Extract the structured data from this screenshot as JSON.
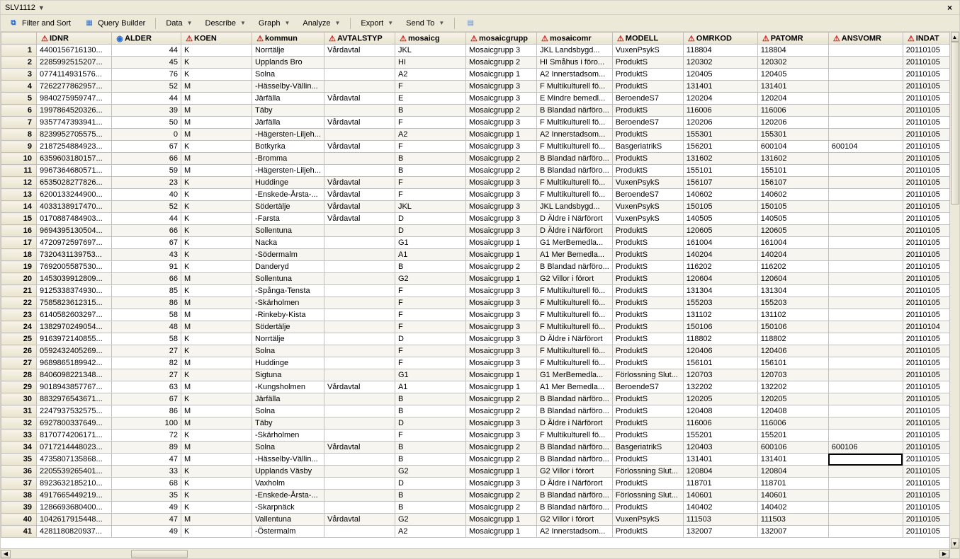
{
  "title": "SLV1112",
  "toolbar": {
    "filterSort": "Filter and Sort",
    "queryBuilder": "Query Builder",
    "data": "Data",
    "describe": "Describe",
    "graph": "Graph",
    "analyze": "Analyze",
    "export": "Export",
    "sendTo": "Send To"
  },
  "columns": [
    {
      "key": "IDNR",
      "label": "IDNR",
      "icon": "warn",
      "w": "col-idnr"
    },
    {
      "key": "ALDER",
      "label": "ALDER",
      "icon": "globe",
      "w": "col-alder"
    },
    {
      "key": "KOEN",
      "label": "KOEN",
      "icon": "warn",
      "w": "col-koen"
    },
    {
      "key": "kommun",
      "label": "kommun",
      "icon": "warn",
      "w": "col-kommun"
    },
    {
      "key": "AVTALSTYP",
      "label": "AVTALSTYP",
      "icon": "warn",
      "w": "col-avtal"
    },
    {
      "key": "mosaicg",
      "label": "mosaicg",
      "icon": "warn",
      "w": "col-mosaicg"
    },
    {
      "key": "mosaicgrupp",
      "label": "mosaicgrupp",
      "icon": "warn",
      "w": "col-mgrp"
    },
    {
      "key": "mosaicomr",
      "label": "mosaicomr",
      "icon": "warn",
      "w": "col-momr"
    },
    {
      "key": "MODELL",
      "label": "MODELL",
      "icon": "warn",
      "w": "col-modell"
    },
    {
      "key": "OMRKOD",
      "label": "OMRKOD",
      "icon": "warn",
      "w": "col-omrkod"
    },
    {
      "key": "PATOMR",
      "label": "PATOMR",
      "icon": "warn",
      "w": "col-patomr"
    },
    {
      "key": "ANSVOMR",
      "label": "ANSVOMR",
      "icon": "warn",
      "w": "col-ansvomr"
    },
    {
      "key": "INDAT",
      "label": "INDAT",
      "icon": "warn",
      "w": "col-indat"
    }
  ],
  "rows": [
    {
      "n": 1,
      "IDNR": "4400156716130...",
      "ALDER": 44,
      "KOEN": "K",
      "kommun": "Norrtälje",
      "AVTALSTYP": "Vårdavtal",
      "mosaicg": "JKL",
      "mosaicgrupp": "Mosaicgrupp 3",
      "mosaicomr": "JKL Landsbygd...",
      "MODELL": "VuxenPsykS",
      "OMRKOD": "118804",
      "PATOMR": "118804",
      "ANSVOMR": "",
      "INDAT": "20110105"
    },
    {
      "n": 2,
      "IDNR": "2285992515207...",
      "ALDER": 45,
      "KOEN": "K",
      "kommun": "Upplands Bro",
      "AVTALSTYP": "",
      "mosaicg": "HI",
      "mosaicgrupp": "Mosaicgrupp 2",
      "mosaicomr": "HI Småhus i föro...",
      "MODELL": "ProduktS",
      "OMRKOD": "120302",
      "PATOMR": "120302",
      "ANSVOMR": "",
      "INDAT": "20110105"
    },
    {
      "n": 3,
      "IDNR": "0774114931576...",
      "ALDER": 76,
      "KOEN": "K",
      "kommun": "Solna",
      "AVTALSTYP": "",
      "mosaicg": "A2",
      "mosaicgrupp": "Mosaicgrupp 1",
      "mosaicomr": "A2 Innerstadsom...",
      "MODELL": "ProduktS",
      "OMRKOD": "120405",
      "PATOMR": "120405",
      "ANSVOMR": "",
      "INDAT": "20110105"
    },
    {
      "n": 4,
      "IDNR": "7262277862957...",
      "ALDER": 52,
      "KOEN": "M",
      "kommun": "-Hässelby-Vällin...",
      "AVTALSTYP": "",
      "mosaicg": "F",
      "mosaicgrupp": "Mosaicgrupp 3",
      "mosaicomr": "F Multikulturell fö...",
      "MODELL": "ProduktS",
      "OMRKOD": "131401",
      "PATOMR": "131401",
      "ANSVOMR": "",
      "INDAT": "20110105"
    },
    {
      "n": 5,
      "IDNR": "9840275959747...",
      "ALDER": 44,
      "KOEN": "M",
      "kommun": "Järfälla",
      "AVTALSTYP": "Vårdavtal",
      "mosaicg": "E",
      "mosaicgrupp": "Mosaicgrupp 3",
      "mosaicomr": "E Mindre bemedl...",
      "MODELL": "BeroendeS7",
      "OMRKOD": "120204",
      "PATOMR": "120204",
      "ANSVOMR": "",
      "INDAT": "20110105"
    },
    {
      "n": 6,
      "IDNR": "1997864520326...",
      "ALDER": 39,
      "KOEN": "M",
      "kommun": "Täby",
      "AVTALSTYP": "",
      "mosaicg": "B",
      "mosaicgrupp": "Mosaicgrupp 2",
      "mosaicomr": "B Blandad närföro...",
      "MODELL": "ProduktS",
      "OMRKOD": "116006",
      "PATOMR": "116006",
      "ANSVOMR": "",
      "INDAT": "20110105"
    },
    {
      "n": 7,
      "IDNR": "9357747393941...",
      "ALDER": 50,
      "KOEN": "M",
      "kommun": "Järfälla",
      "AVTALSTYP": "Vårdavtal",
      "mosaicg": "F",
      "mosaicgrupp": "Mosaicgrupp 3",
      "mosaicomr": "F Multikulturell fö...",
      "MODELL": "BeroendeS7",
      "OMRKOD": "120206",
      "PATOMR": "120206",
      "ANSVOMR": "",
      "INDAT": "20110105"
    },
    {
      "n": 8,
      "IDNR": "8239952705575...",
      "ALDER": 0,
      "KOEN": "M",
      "kommun": "-Hägersten-Liljeh...",
      "AVTALSTYP": "",
      "mosaicg": "A2",
      "mosaicgrupp": "Mosaicgrupp 1",
      "mosaicomr": "A2 Innerstadsom...",
      "MODELL": "ProduktS",
      "OMRKOD": "155301",
      "PATOMR": "155301",
      "ANSVOMR": "",
      "INDAT": "20110105"
    },
    {
      "n": 9,
      "IDNR": "2187254884923...",
      "ALDER": 67,
      "KOEN": "K",
      "kommun": "Botkyrka",
      "AVTALSTYP": "Vårdavtal",
      "mosaicg": "F",
      "mosaicgrupp": "Mosaicgrupp 3",
      "mosaicomr": "F Multikulturell fö...",
      "MODELL": "BasgeriatrikS",
      "OMRKOD": "156201",
      "PATOMR": "600104",
      "ANSVOMR": "600104",
      "INDAT": "20110105"
    },
    {
      "n": 10,
      "IDNR": "6359603180157...",
      "ALDER": 66,
      "KOEN": "M",
      "kommun": "-Bromma",
      "AVTALSTYP": "",
      "mosaicg": "B",
      "mosaicgrupp": "Mosaicgrupp 2",
      "mosaicomr": "B Blandad närföro...",
      "MODELL": "ProduktS",
      "OMRKOD": "131602",
      "PATOMR": "131602",
      "ANSVOMR": "",
      "INDAT": "20110105"
    },
    {
      "n": 11,
      "IDNR": "9967364680571...",
      "ALDER": 59,
      "KOEN": "M",
      "kommun": "-Hägersten-Liljeh...",
      "AVTALSTYP": "",
      "mosaicg": "B",
      "mosaicgrupp": "Mosaicgrupp 2",
      "mosaicomr": "B Blandad närföro...",
      "MODELL": "ProduktS",
      "OMRKOD": "155101",
      "PATOMR": "155101",
      "ANSVOMR": "",
      "INDAT": "20110105"
    },
    {
      "n": 12,
      "IDNR": "6535028277826...",
      "ALDER": 23,
      "KOEN": "K",
      "kommun": "Huddinge",
      "AVTALSTYP": "Vårdavtal",
      "mosaicg": "F",
      "mosaicgrupp": "Mosaicgrupp 3",
      "mosaicomr": "F Multikulturell fö...",
      "MODELL": "VuxenPsykS",
      "OMRKOD": "156107",
      "PATOMR": "156107",
      "ANSVOMR": "",
      "INDAT": "20110105"
    },
    {
      "n": 13,
      "IDNR": "6200133244900...",
      "ALDER": 40,
      "KOEN": "K",
      "kommun": "-Enskede-Årsta-...",
      "AVTALSTYP": "Vårdavtal",
      "mosaicg": "F",
      "mosaicgrupp": "Mosaicgrupp 3",
      "mosaicomr": "F Multikulturell fö...",
      "MODELL": "BeroendeS7",
      "OMRKOD": "140602",
      "PATOMR": "140602",
      "ANSVOMR": "",
      "INDAT": "20110105"
    },
    {
      "n": 14,
      "IDNR": "4033138917470...",
      "ALDER": 52,
      "KOEN": "K",
      "kommun": "Södertälje",
      "AVTALSTYP": "Vårdavtal",
      "mosaicg": "JKL",
      "mosaicgrupp": "Mosaicgrupp 3",
      "mosaicomr": "JKL Landsbygd...",
      "MODELL": "VuxenPsykS",
      "OMRKOD": "150105",
      "PATOMR": "150105",
      "ANSVOMR": "",
      "INDAT": "20110105"
    },
    {
      "n": 15,
      "IDNR": "0170887484903...",
      "ALDER": 44,
      "KOEN": "K",
      "kommun": "-Farsta",
      "AVTALSTYP": "Vårdavtal",
      "mosaicg": "D",
      "mosaicgrupp": "Mosaicgrupp 3",
      "mosaicomr": "D Äldre i Närförort",
      "MODELL": "VuxenPsykS",
      "OMRKOD": "140505",
      "PATOMR": "140505",
      "ANSVOMR": "",
      "INDAT": "20110105"
    },
    {
      "n": 16,
      "IDNR": "9694395130504...",
      "ALDER": 66,
      "KOEN": "K",
      "kommun": "Sollentuna",
      "AVTALSTYP": "",
      "mosaicg": "D",
      "mosaicgrupp": "Mosaicgrupp 3",
      "mosaicomr": "D Äldre i Närförort",
      "MODELL": "ProduktS",
      "OMRKOD": "120605",
      "PATOMR": "120605",
      "ANSVOMR": "",
      "INDAT": "20110105"
    },
    {
      "n": 17,
      "IDNR": "4720972597697...",
      "ALDER": 67,
      "KOEN": "K",
      "kommun": "Nacka",
      "AVTALSTYP": "",
      "mosaicg": "G1",
      "mosaicgrupp": "Mosaicgrupp 1",
      "mosaicomr": "G1 MerBemedla...",
      "MODELL": "ProduktS",
      "OMRKOD": "161004",
      "PATOMR": "161004",
      "ANSVOMR": "",
      "INDAT": "20110105"
    },
    {
      "n": 18,
      "IDNR": "7320431139753...",
      "ALDER": 43,
      "KOEN": "K",
      "kommun": "-Södermalm",
      "AVTALSTYP": "",
      "mosaicg": "A1",
      "mosaicgrupp": "Mosaicgrupp 1",
      "mosaicomr": "A1 Mer Bemedla...",
      "MODELL": "ProduktS",
      "OMRKOD": "140204",
      "PATOMR": "140204",
      "ANSVOMR": "",
      "INDAT": "20110105"
    },
    {
      "n": 19,
      "IDNR": "7692005587530...",
      "ALDER": 91,
      "KOEN": "K",
      "kommun": "Danderyd",
      "AVTALSTYP": "",
      "mosaicg": "B",
      "mosaicgrupp": "Mosaicgrupp 2",
      "mosaicomr": "B Blandad närföro...",
      "MODELL": "ProduktS",
      "OMRKOD": "116202",
      "PATOMR": "116202",
      "ANSVOMR": "",
      "INDAT": "20110105"
    },
    {
      "n": 20,
      "IDNR": "1453039912809...",
      "ALDER": 66,
      "KOEN": "M",
      "kommun": "Sollentuna",
      "AVTALSTYP": "",
      "mosaicg": "G2",
      "mosaicgrupp": "Mosaicgrupp 1",
      "mosaicomr": "G2 Villor i förort",
      "MODELL": "ProduktS",
      "OMRKOD": "120604",
      "PATOMR": "120604",
      "ANSVOMR": "",
      "INDAT": "20110105"
    },
    {
      "n": 21,
      "IDNR": "9125338374930...",
      "ALDER": 85,
      "KOEN": "K",
      "kommun": "-Spånga-Tensta",
      "AVTALSTYP": "",
      "mosaicg": "F",
      "mosaicgrupp": "Mosaicgrupp 3",
      "mosaicomr": "F Multikulturell fö...",
      "MODELL": "ProduktS",
      "OMRKOD": "131304",
      "PATOMR": "131304",
      "ANSVOMR": "",
      "INDAT": "20110105"
    },
    {
      "n": 22,
      "IDNR": "7585823612315...",
      "ALDER": 86,
      "KOEN": "M",
      "kommun": "-Skärholmen",
      "AVTALSTYP": "",
      "mosaicg": "F",
      "mosaicgrupp": "Mosaicgrupp 3",
      "mosaicomr": "F Multikulturell fö...",
      "MODELL": "ProduktS",
      "OMRKOD": "155203",
      "PATOMR": "155203",
      "ANSVOMR": "",
      "INDAT": "20110105"
    },
    {
      "n": 23,
      "IDNR": "6140582603297...",
      "ALDER": 58,
      "KOEN": "M",
      "kommun": "-Rinkeby-Kista",
      "AVTALSTYP": "",
      "mosaicg": "F",
      "mosaicgrupp": "Mosaicgrupp 3",
      "mosaicomr": "F Multikulturell fö...",
      "MODELL": "ProduktS",
      "OMRKOD": "131102",
      "PATOMR": "131102",
      "ANSVOMR": "",
      "INDAT": "20110105"
    },
    {
      "n": 24,
      "IDNR": "1382970249054...",
      "ALDER": 48,
      "KOEN": "M",
      "kommun": "Södertälje",
      "AVTALSTYP": "",
      "mosaicg": "F",
      "mosaicgrupp": "Mosaicgrupp 3",
      "mosaicomr": "F Multikulturell fö...",
      "MODELL": "ProduktS",
      "OMRKOD": "150106",
      "PATOMR": "150106",
      "ANSVOMR": "",
      "INDAT": "20110104"
    },
    {
      "n": 25,
      "IDNR": "9163972140855...",
      "ALDER": 58,
      "KOEN": "K",
      "kommun": "Norrtälje",
      "AVTALSTYP": "",
      "mosaicg": "D",
      "mosaicgrupp": "Mosaicgrupp 3",
      "mosaicomr": "D Äldre i Närförort",
      "MODELL": "ProduktS",
      "OMRKOD": "118802",
      "PATOMR": "118802",
      "ANSVOMR": "",
      "INDAT": "20110105"
    },
    {
      "n": 26,
      "IDNR": "0592432405269...",
      "ALDER": 27,
      "KOEN": "K",
      "kommun": "Solna",
      "AVTALSTYP": "",
      "mosaicg": "F",
      "mosaicgrupp": "Mosaicgrupp 3",
      "mosaicomr": "F Multikulturell fö...",
      "MODELL": "ProduktS",
      "OMRKOD": "120406",
      "PATOMR": "120406",
      "ANSVOMR": "",
      "INDAT": "20110105"
    },
    {
      "n": 27,
      "IDNR": "9689865189942...",
      "ALDER": 82,
      "KOEN": "M",
      "kommun": "Huddinge",
      "AVTALSTYP": "",
      "mosaicg": "F",
      "mosaicgrupp": "Mosaicgrupp 3",
      "mosaicomr": "F Multikulturell fö...",
      "MODELL": "ProduktS",
      "OMRKOD": "156101",
      "PATOMR": "156101",
      "ANSVOMR": "",
      "INDAT": "20110105"
    },
    {
      "n": 28,
      "IDNR": "8406098221348...",
      "ALDER": 27,
      "KOEN": "K",
      "kommun": "Sigtuna",
      "AVTALSTYP": "",
      "mosaicg": "G1",
      "mosaicgrupp": "Mosaicgrupp 1",
      "mosaicomr": "G1 MerBemedla...",
      "MODELL": "Förlossning Slut...",
      "OMRKOD": "120703",
      "PATOMR": "120703",
      "ANSVOMR": "",
      "INDAT": "20110105"
    },
    {
      "n": 29,
      "IDNR": "9018943857767...",
      "ALDER": 63,
      "KOEN": "M",
      "kommun": "-Kungsholmen",
      "AVTALSTYP": "Vårdavtal",
      "mosaicg": "A1",
      "mosaicgrupp": "Mosaicgrupp 1",
      "mosaicomr": "A1 Mer Bemedla...",
      "MODELL": "BeroendeS7",
      "OMRKOD": "132202",
      "PATOMR": "132202",
      "ANSVOMR": "",
      "INDAT": "20110105"
    },
    {
      "n": 30,
      "IDNR": "8832976543671...",
      "ALDER": 67,
      "KOEN": "K",
      "kommun": "Järfälla",
      "AVTALSTYP": "",
      "mosaicg": "B",
      "mosaicgrupp": "Mosaicgrupp 2",
      "mosaicomr": "B Blandad närföro...",
      "MODELL": "ProduktS",
      "OMRKOD": "120205",
      "PATOMR": "120205",
      "ANSVOMR": "",
      "INDAT": "20110105"
    },
    {
      "n": 31,
      "IDNR": "2247937532575...",
      "ALDER": 86,
      "KOEN": "M",
      "kommun": "Solna",
      "AVTALSTYP": "",
      "mosaicg": "B",
      "mosaicgrupp": "Mosaicgrupp 2",
      "mosaicomr": "B Blandad närföro...",
      "MODELL": "ProduktS",
      "OMRKOD": "120408",
      "PATOMR": "120408",
      "ANSVOMR": "",
      "INDAT": "20110105"
    },
    {
      "n": 32,
      "IDNR": "6927800337649...",
      "ALDER": 100,
      "KOEN": "M",
      "kommun": "Täby",
      "AVTALSTYP": "",
      "mosaicg": "D",
      "mosaicgrupp": "Mosaicgrupp 3",
      "mosaicomr": "D Äldre i Närförort",
      "MODELL": "ProduktS",
      "OMRKOD": "116006",
      "PATOMR": "116006",
      "ANSVOMR": "",
      "INDAT": "20110105"
    },
    {
      "n": 33,
      "IDNR": "8170774206171...",
      "ALDER": 72,
      "KOEN": "K",
      "kommun": "-Skärholmen",
      "AVTALSTYP": "",
      "mosaicg": "F",
      "mosaicgrupp": "Mosaicgrupp 3",
      "mosaicomr": "F Multikulturell fö...",
      "MODELL": "ProduktS",
      "OMRKOD": "155201",
      "PATOMR": "155201",
      "ANSVOMR": "",
      "INDAT": "20110105"
    },
    {
      "n": 34,
      "IDNR": "0717214448023...",
      "ALDER": 89,
      "KOEN": "M",
      "kommun": "Solna",
      "AVTALSTYP": "Vårdavtal",
      "mosaicg": "B",
      "mosaicgrupp": "Mosaicgrupp 2",
      "mosaicomr": "B Blandad närföro...",
      "MODELL": "BasgeriatrikS",
      "OMRKOD": "120403",
      "PATOMR": "600106",
      "ANSVOMR": "600106",
      "INDAT": "20110105"
    },
    {
      "n": 35,
      "IDNR": "4735807135868...",
      "ALDER": 47,
      "KOEN": "M",
      "kommun": "-Hässelby-Vällin...",
      "AVTALSTYP": "",
      "mosaicg": "B",
      "mosaicgrupp": "Mosaicgrupp 2",
      "mosaicomr": "B Blandad närföro...",
      "MODELL": "ProduktS",
      "OMRKOD": "131401",
      "PATOMR": "131401",
      "ANSVOMR": "",
      "INDAT": "20110105",
      "selectedCol": "ANSVOMR"
    },
    {
      "n": 36,
      "IDNR": "2205539265401...",
      "ALDER": 33,
      "KOEN": "K",
      "kommun": "Upplands Väsby",
      "AVTALSTYP": "",
      "mosaicg": "G2",
      "mosaicgrupp": "Mosaicgrupp 1",
      "mosaicomr": "G2 Villor i förort",
      "MODELL": "Förlossning Slut...",
      "OMRKOD": "120804",
      "PATOMR": "120804",
      "ANSVOMR": "",
      "INDAT": "20110105"
    },
    {
      "n": 37,
      "IDNR": "8923632185210...",
      "ALDER": 68,
      "KOEN": "K",
      "kommun": "Vaxholm",
      "AVTALSTYP": "",
      "mosaicg": "D",
      "mosaicgrupp": "Mosaicgrupp 3",
      "mosaicomr": "D Äldre i Närförort",
      "MODELL": "ProduktS",
      "OMRKOD": "118701",
      "PATOMR": "118701",
      "ANSVOMR": "",
      "INDAT": "20110105"
    },
    {
      "n": 38,
      "IDNR": "4917665449219...",
      "ALDER": 35,
      "KOEN": "K",
      "kommun": "-Enskede-Årsta-...",
      "AVTALSTYP": "",
      "mosaicg": "B",
      "mosaicgrupp": "Mosaicgrupp 2",
      "mosaicomr": "B Blandad närföro...",
      "MODELL": "Förlossning Slut...",
      "OMRKOD": "140601",
      "PATOMR": "140601",
      "ANSVOMR": "",
      "INDAT": "20110105"
    },
    {
      "n": 39,
      "IDNR": "1286693680400...",
      "ALDER": 49,
      "KOEN": "K",
      "kommun": "-Skarpnäck",
      "AVTALSTYP": "",
      "mosaicg": "B",
      "mosaicgrupp": "Mosaicgrupp 2",
      "mosaicomr": "B Blandad närföro...",
      "MODELL": "ProduktS",
      "OMRKOD": "140402",
      "PATOMR": "140402",
      "ANSVOMR": "",
      "INDAT": "20110105"
    },
    {
      "n": 40,
      "IDNR": "1042617915448...",
      "ALDER": 47,
      "KOEN": "M",
      "kommun": "Vallentuna",
      "AVTALSTYP": "Vårdavtal",
      "mosaicg": "G2",
      "mosaicgrupp": "Mosaicgrupp 1",
      "mosaicomr": "G2 Villor i förort",
      "MODELL": "VuxenPsykS",
      "OMRKOD": "111503",
      "PATOMR": "111503",
      "ANSVOMR": "",
      "INDAT": "20110105"
    },
    {
      "n": 41,
      "IDNR": "4281180820937...",
      "ALDER": 49,
      "KOEN": "K",
      "kommun": "-Östermalm",
      "AVTALSTYP": "",
      "mosaicg": "A2",
      "mosaicgrupp": "Mosaicgrupp 1",
      "mosaicomr": "A2 Innerstadsom...",
      "MODELL": "ProduktS",
      "OMRKOD": "132007",
      "PATOMR": "132007",
      "ANSVOMR": "",
      "INDAT": "20110105"
    }
  ]
}
